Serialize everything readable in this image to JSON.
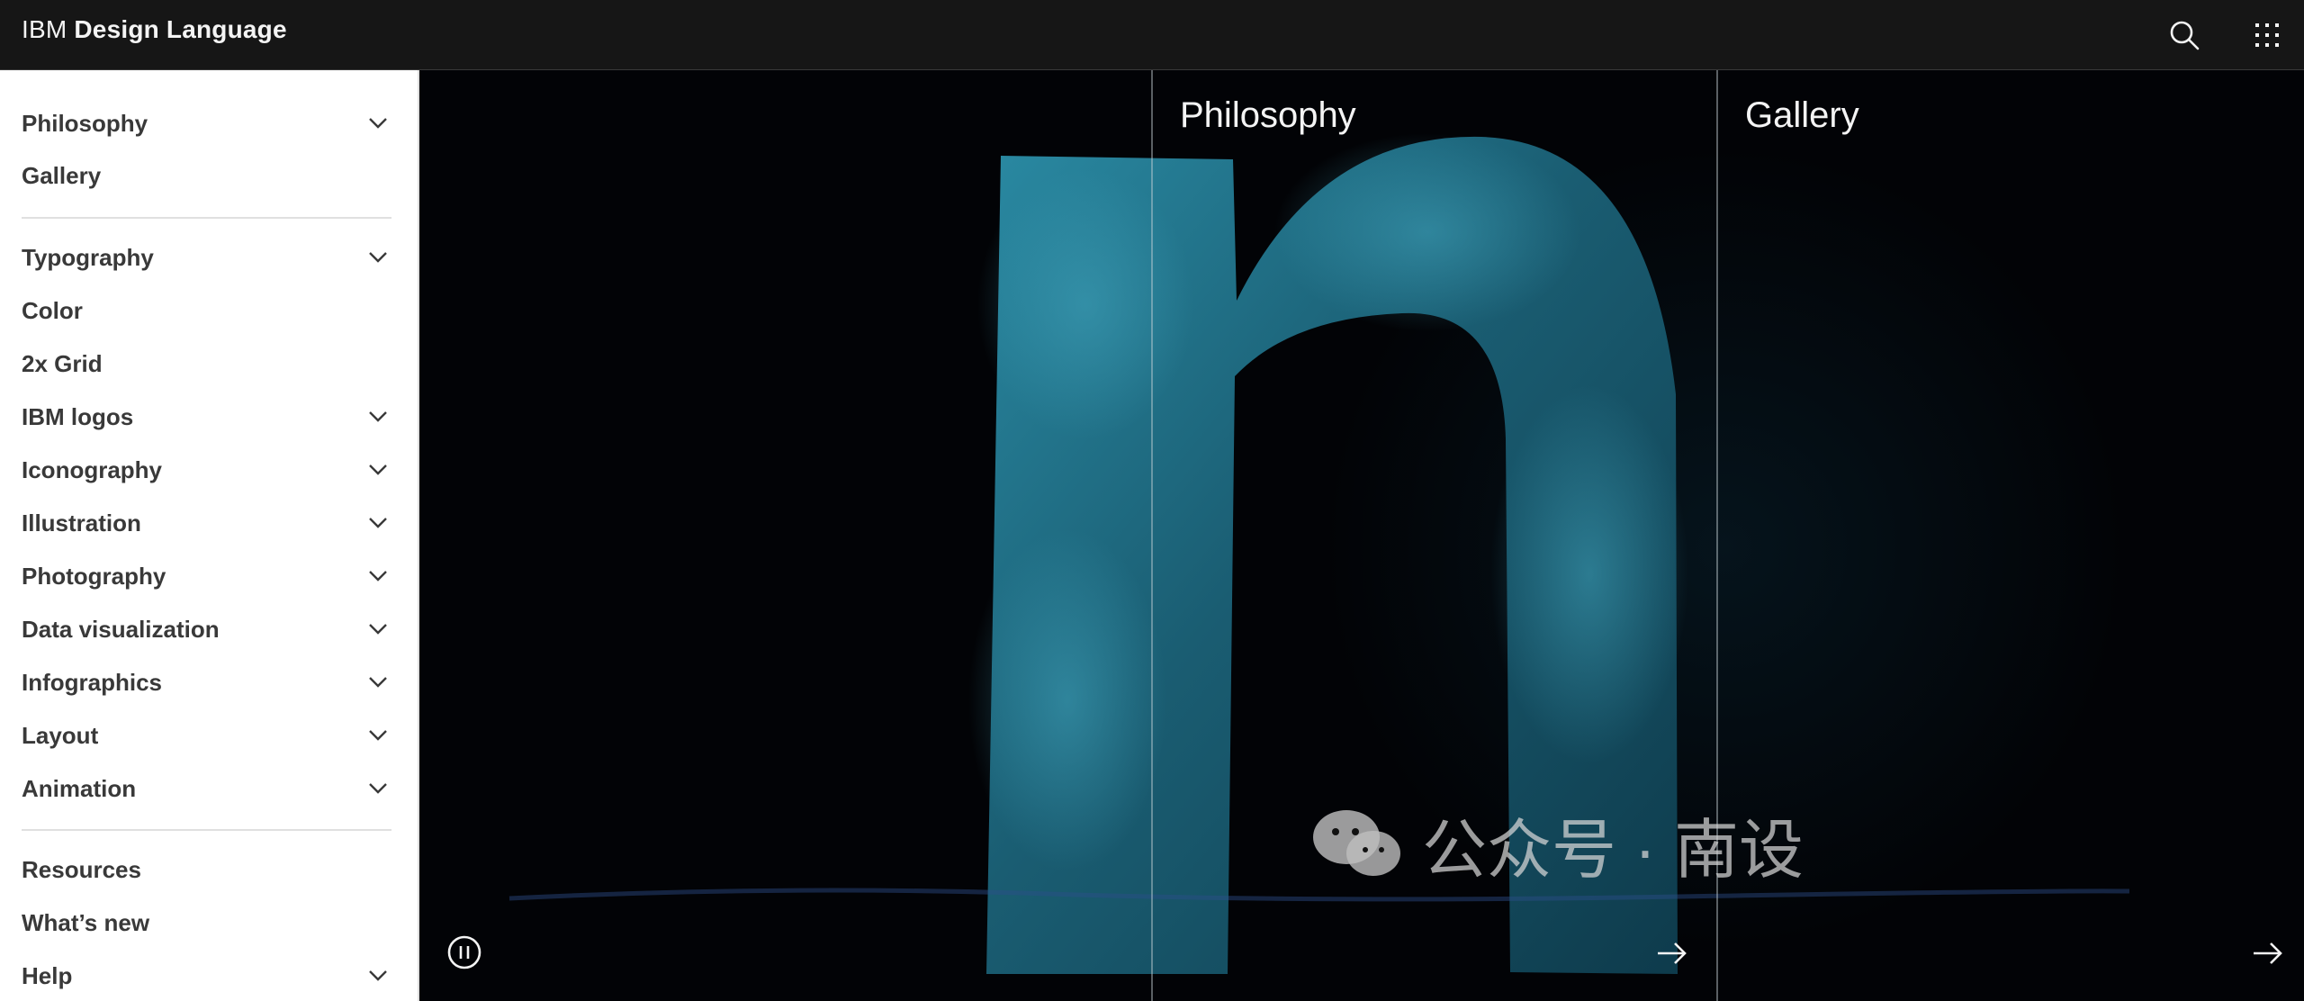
{
  "header": {
    "brand_prefix": "IBM",
    "brand_name": "Design Language",
    "search_icon": "search-icon",
    "switcher_icon": "app-switcher-icon"
  },
  "sidebar": {
    "group1": [
      {
        "label": "Philosophy",
        "expandable": true
      },
      {
        "label": "Gallery",
        "expandable": false
      }
    ],
    "group2": [
      {
        "label": "Typography",
        "expandable": true
      },
      {
        "label": "Color",
        "expandable": false
      },
      {
        "label": "2x Grid",
        "expandable": false
      },
      {
        "label": "IBM logos",
        "expandable": true
      },
      {
        "label": "Iconography",
        "expandable": true
      },
      {
        "label": "Illustration",
        "expandable": true
      },
      {
        "label": "Photography",
        "expandable": true
      },
      {
        "label": "Data visualization",
        "expandable": true
      },
      {
        "label": "Infographics",
        "expandable": true
      },
      {
        "label": "Layout",
        "expandable": true
      },
      {
        "label": "Animation",
        "expandable": true
      }
    ],
    "group3": [
      {
        "label": "Resources",
        "expandable": false
      },
      {
        "label": "What’s new",
        "expandable": false
      },
      {
        "label": "Help",
        "expandable": true
      }
    ]
  },
  "hero": {
    "panels": [
      {
        "title": "Philosophy"
      },
      {
        "title": "Gallery"
      }
    ],
    "pause_icon": "pause-icon",
    "arrow_icon": "arrow-right-icon"
  },
  "watermark": {
    "text": "公众号 · 南设",
    "icon": "wechat-icon"
  },
  "colors": {
    "header_bg": "#161616",
    "sidebar_bg": "#ffffff",
    "nav_text": "#393939",
    "hero_bg": "#020306",
    "letter_fill": "#1a5d72"
  }
}
